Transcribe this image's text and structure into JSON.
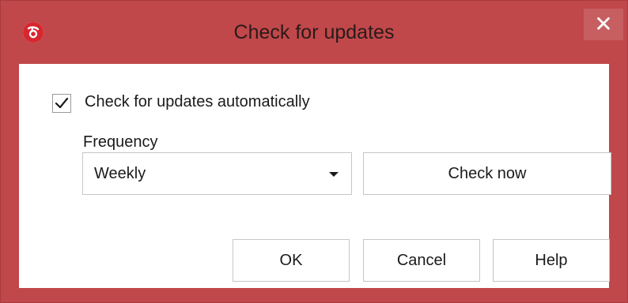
{
  "window": {
    "title": "Check for updates",
    "close_glyph": "✕",
    "app_icon": "app-logo-icon",
    "accent_color": "#c0484a"
  },
  "options": {
    "auto_check_label": "Check for updates automatically",
    "auto_check_checked": true,
    "frequency_label": "Frequency",
    "frequency_value": "Weekly",
    "check_now_label": "Check now"
  },
  "buttons": {
    "ok": "OK",
    "cancel": "Cancel",
    "help": "Help"
  }
}
